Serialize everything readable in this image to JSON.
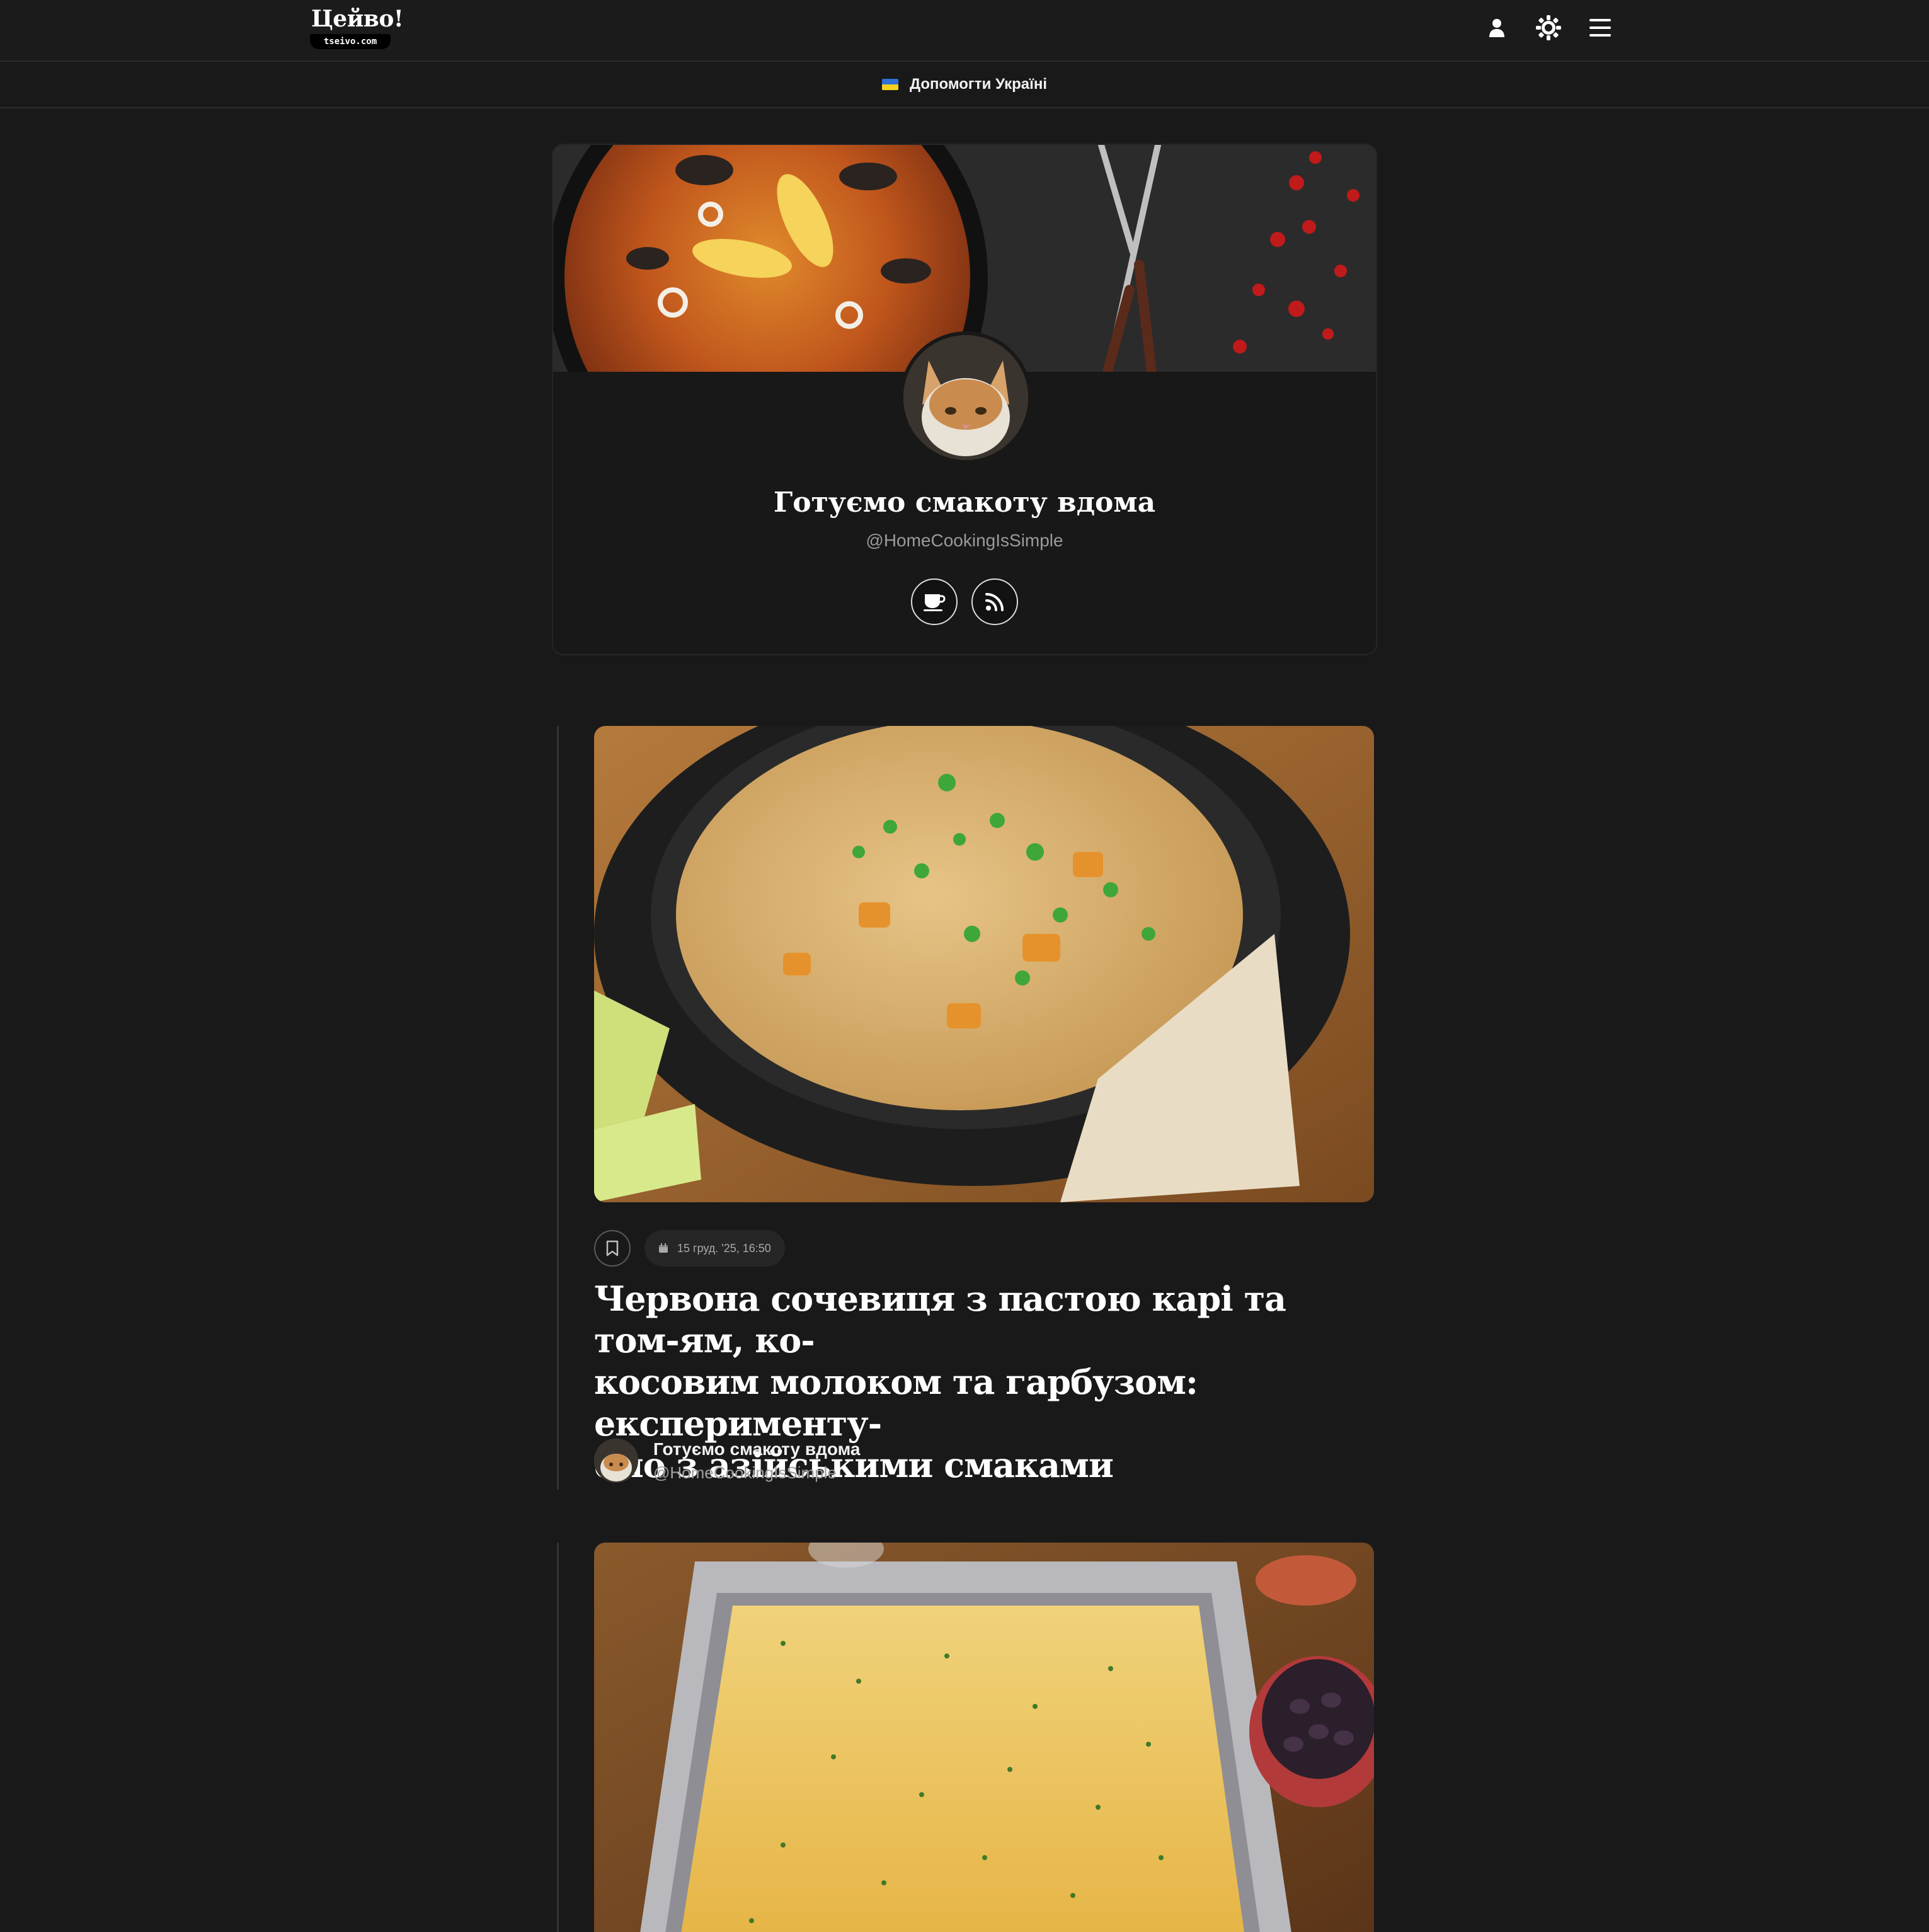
{
  "header": {
    "logo_text": "Цейво!",
    "logo_domain": "tseivo.com",
    "icons": [
      "user-icon",
      "sun-icon",
      "menu-icon"
    ]
  },
  "support_bar": {
    "label": "Допомогти Україні",
    "flag_colors": [
      "#2f6fd6",
      "#f4d11f"
    ]
  },
  "profile": {
    "name": "Готуємо смакоту вдома",
    "handle": "@HomeCookingIsSimple",
    "action_icons": [
      "coffee-icon",
      "rss-icon"
    ]
  },
  "posts": [
    {
      "date": "15 груд. '25, 16:50",
      "title": "Червона сочевиця з пастою карі та том-ям, ко-косовим молоком та гарбузом: експеримент у-ємо з азійськими смаками",
      "title_lines": [
        "Червона сочевиця з пастою карі та том-ям, ко-",
        "косовим молоком та гарбузом: експерименту-",
        "ємо з азійськими смаками"
      ],
      "author_name": "Готуємо смакоту вдома",
      "author_handle": "@HomeCookingIsSimple"
    },
    {
      "date": "",
      "title": "",
      "author_name": "",
      "author_handle": ""
    }
  ],
  "colors": {
    "background": "#191919",
    "card_border": "#262626",
    "muted_text": "#9a9a9a"
  }
}
